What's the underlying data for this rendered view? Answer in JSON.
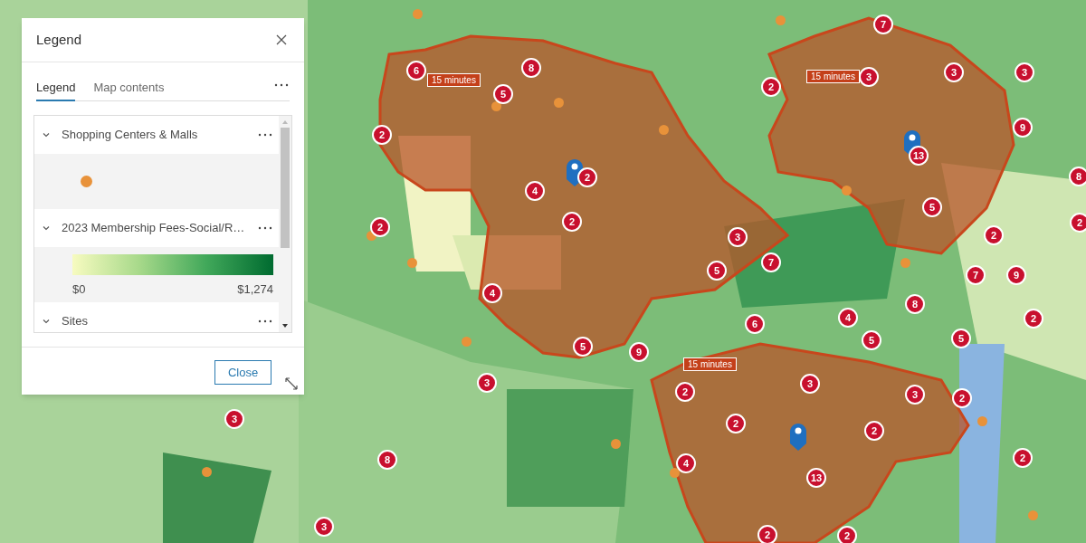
{
  "legend_panel": {
    "title": "Legend",
    "tabs": [
      {
        "label": "Legend",
        "selected": true
      },
      {
        "label": "Map contents",
        "selected": false
      }
    ],
    "layers": [
      {
        "kind": "point",
        "name": "Shopping Centers & Malls",
        "expanded": true
      },
      {
        "kind": "ramp",
        "name": "2023 Membership Fees-Social/R…",
        "expanded": true,
        "min_label": "$0",
        "max_label": "$1,274"
      },
      {
        "kind": "group",
        "name": "Sites",
        "expanded": true
      }
    ],
    "close_button": "Close"
  },
  "map": {
    "drive_time_labels": [
      "15 minutes",
      "15 minutes",
      "15 minutes"
    ],
    "cluster_markers": [
      "6",
      "8",
      "5",
      "2",
      "4",
      "2",
      "2",
      "2",
      "4",
      "5",
      "9",
      "3",
      "5",
      "7",
      "6",
      "2",
      "7",
      "3",
      "3",
      "3",
      "9",
      "13",
      "8",
      "2",
      "5",
      "2",
      "7",
      "9",
      "8",
      "4",
      "5",
      "5",
      "2",
      "2",
      "3",
      "3",
      "2",
      "3",
      "3",
      "8",
      "2",
      "2",
      "4",
      "13",
      "2",
      "3",
      "2",
      "2"
    ]
  }
}
